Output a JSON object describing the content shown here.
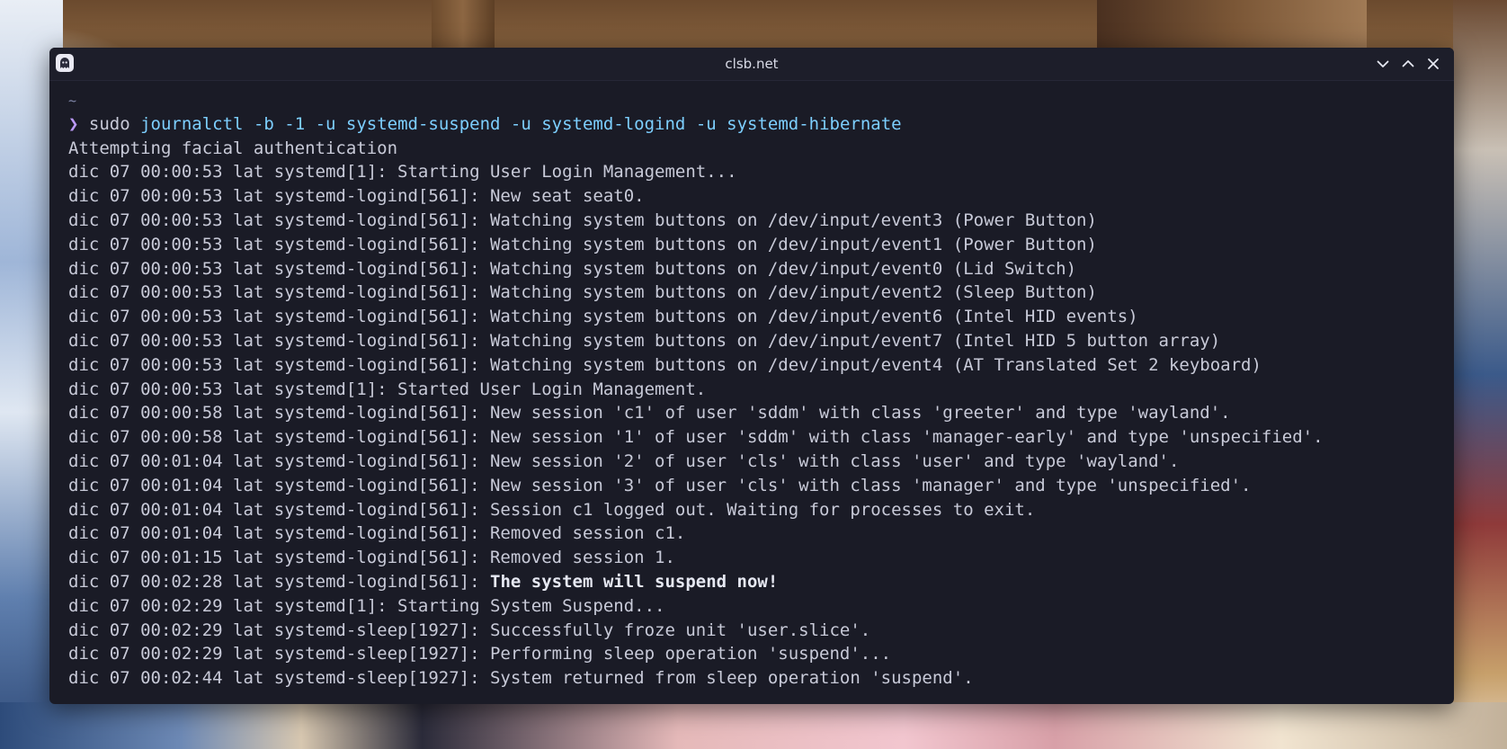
{
  "window": {
    "title": "clsb.net",
    "icon": "ghost-icon",
    "buttons": [
      "minimize",
      "maximize",
      "close"
    ]
  },
  "terminal": {
    "cwd": "~",
    "prompt_symbol": "❯",
    "command_name": "sudo",
    "command_args": " journalctl -b -1 -u systemd-suspend -u systemd-logind -u systemd-hibernate",
    "colors": {
      "background": "#1a1b26",
      "foreground": "#c8cad8",
      "prompt": "#bb9af7",
      "args": "#7dcfff"
    },
    "lines": [
      "Attempting facial authentication",
      "dic 07 00:00:53 lat systemd[1]: Starting User Login Management...",
      "dic 07 00:00:53 lat systemd-logind[561]: New seat seat0.",
      "dic 07 00:00:53 lat systemd-logind[561]: Watching system buttons on /dev/input/event3 (Power Button)",
      "dic 07 00:00:53 lat systemd-logind[561]: Watching system buttons on /dev/input/event1 (Power Button)",
      "dic 07 00:00:53 lat systemd-logind[561]: Watching system buttons on /dev/input/event0 (Lid Switch)",
      "dic 07 00:00:53 lat systemd-logind[561]: Watching system buttons on /dev/input/event2 (Sleep Button)",
      "dic 07 00:00:53 lat systemd-logind[561]: Watching system buttons on /dev/input/event6 (Intel HID events)",
      "dic 07 00:00:53 lat systemd-logind[561]: Watching system buttons on /dev/input/event7 (Intel HID 5 button array)",
      "dic 07 00:00:53 lat systemd-logind[561]: Watching system buttons on /dev/input/event4 (AT Translated Set 2 keyboard)",
      "dic 07 00:00:53 lat systemd[1]: Started User Login Management.",
      "dic 07 00:00:58 lat systemd-logind[561]: New session 'c1' of user 'sddm' with class 'greeter' and type 'wayland'.",
      "dic 07 00:00:58 lat systemd-logind[561]: New session '1' of user 'sddm' with class 'manager-early' and type 'unspecified'.",
      "dic 07 00:01:04 lat systemd-logind[561]: New session '2' of user 'cls' with class 'user' and type 'wayland'.",
      "dic 07 00:01:04 lat systemd-logind[561]: New session '3' of user 'cls' with class 'manager' and type 'unspecified'.",
      "dic 07 00:01:04 lat systemd-logind[561]: Session c1 logged out. Waiting for processes to exit.",
      "dic 07 00:01:04 lat systemd-logind[561]: Removed session c1.",
      "dic 07 00:01:15 lat systemd-logind[561]: Removed session 1."
    ],
    "suspend_line": {
      "prefix": "dic 07 00:02:28 lat systemd-logind[561]: ",
      "message": "The system will suspend now!"
    },
    "lines_after": [
      "dic 07 00:02:29 lat systemd[1]: Starting System Suspend...",
      "dic 07 00:02:29 lat systemd-sleep[1927]: Successfully froze unit 'user.slice'.",
      "dic 07 00:02:29 lat systemd-sleep[1927]: Performing sleep operation 'suspend'...",
      "dic 07 00:02:44 lat systemd-sleep[1927]: System returned from sleep operation 'suspend'."
    ]
  }
}
